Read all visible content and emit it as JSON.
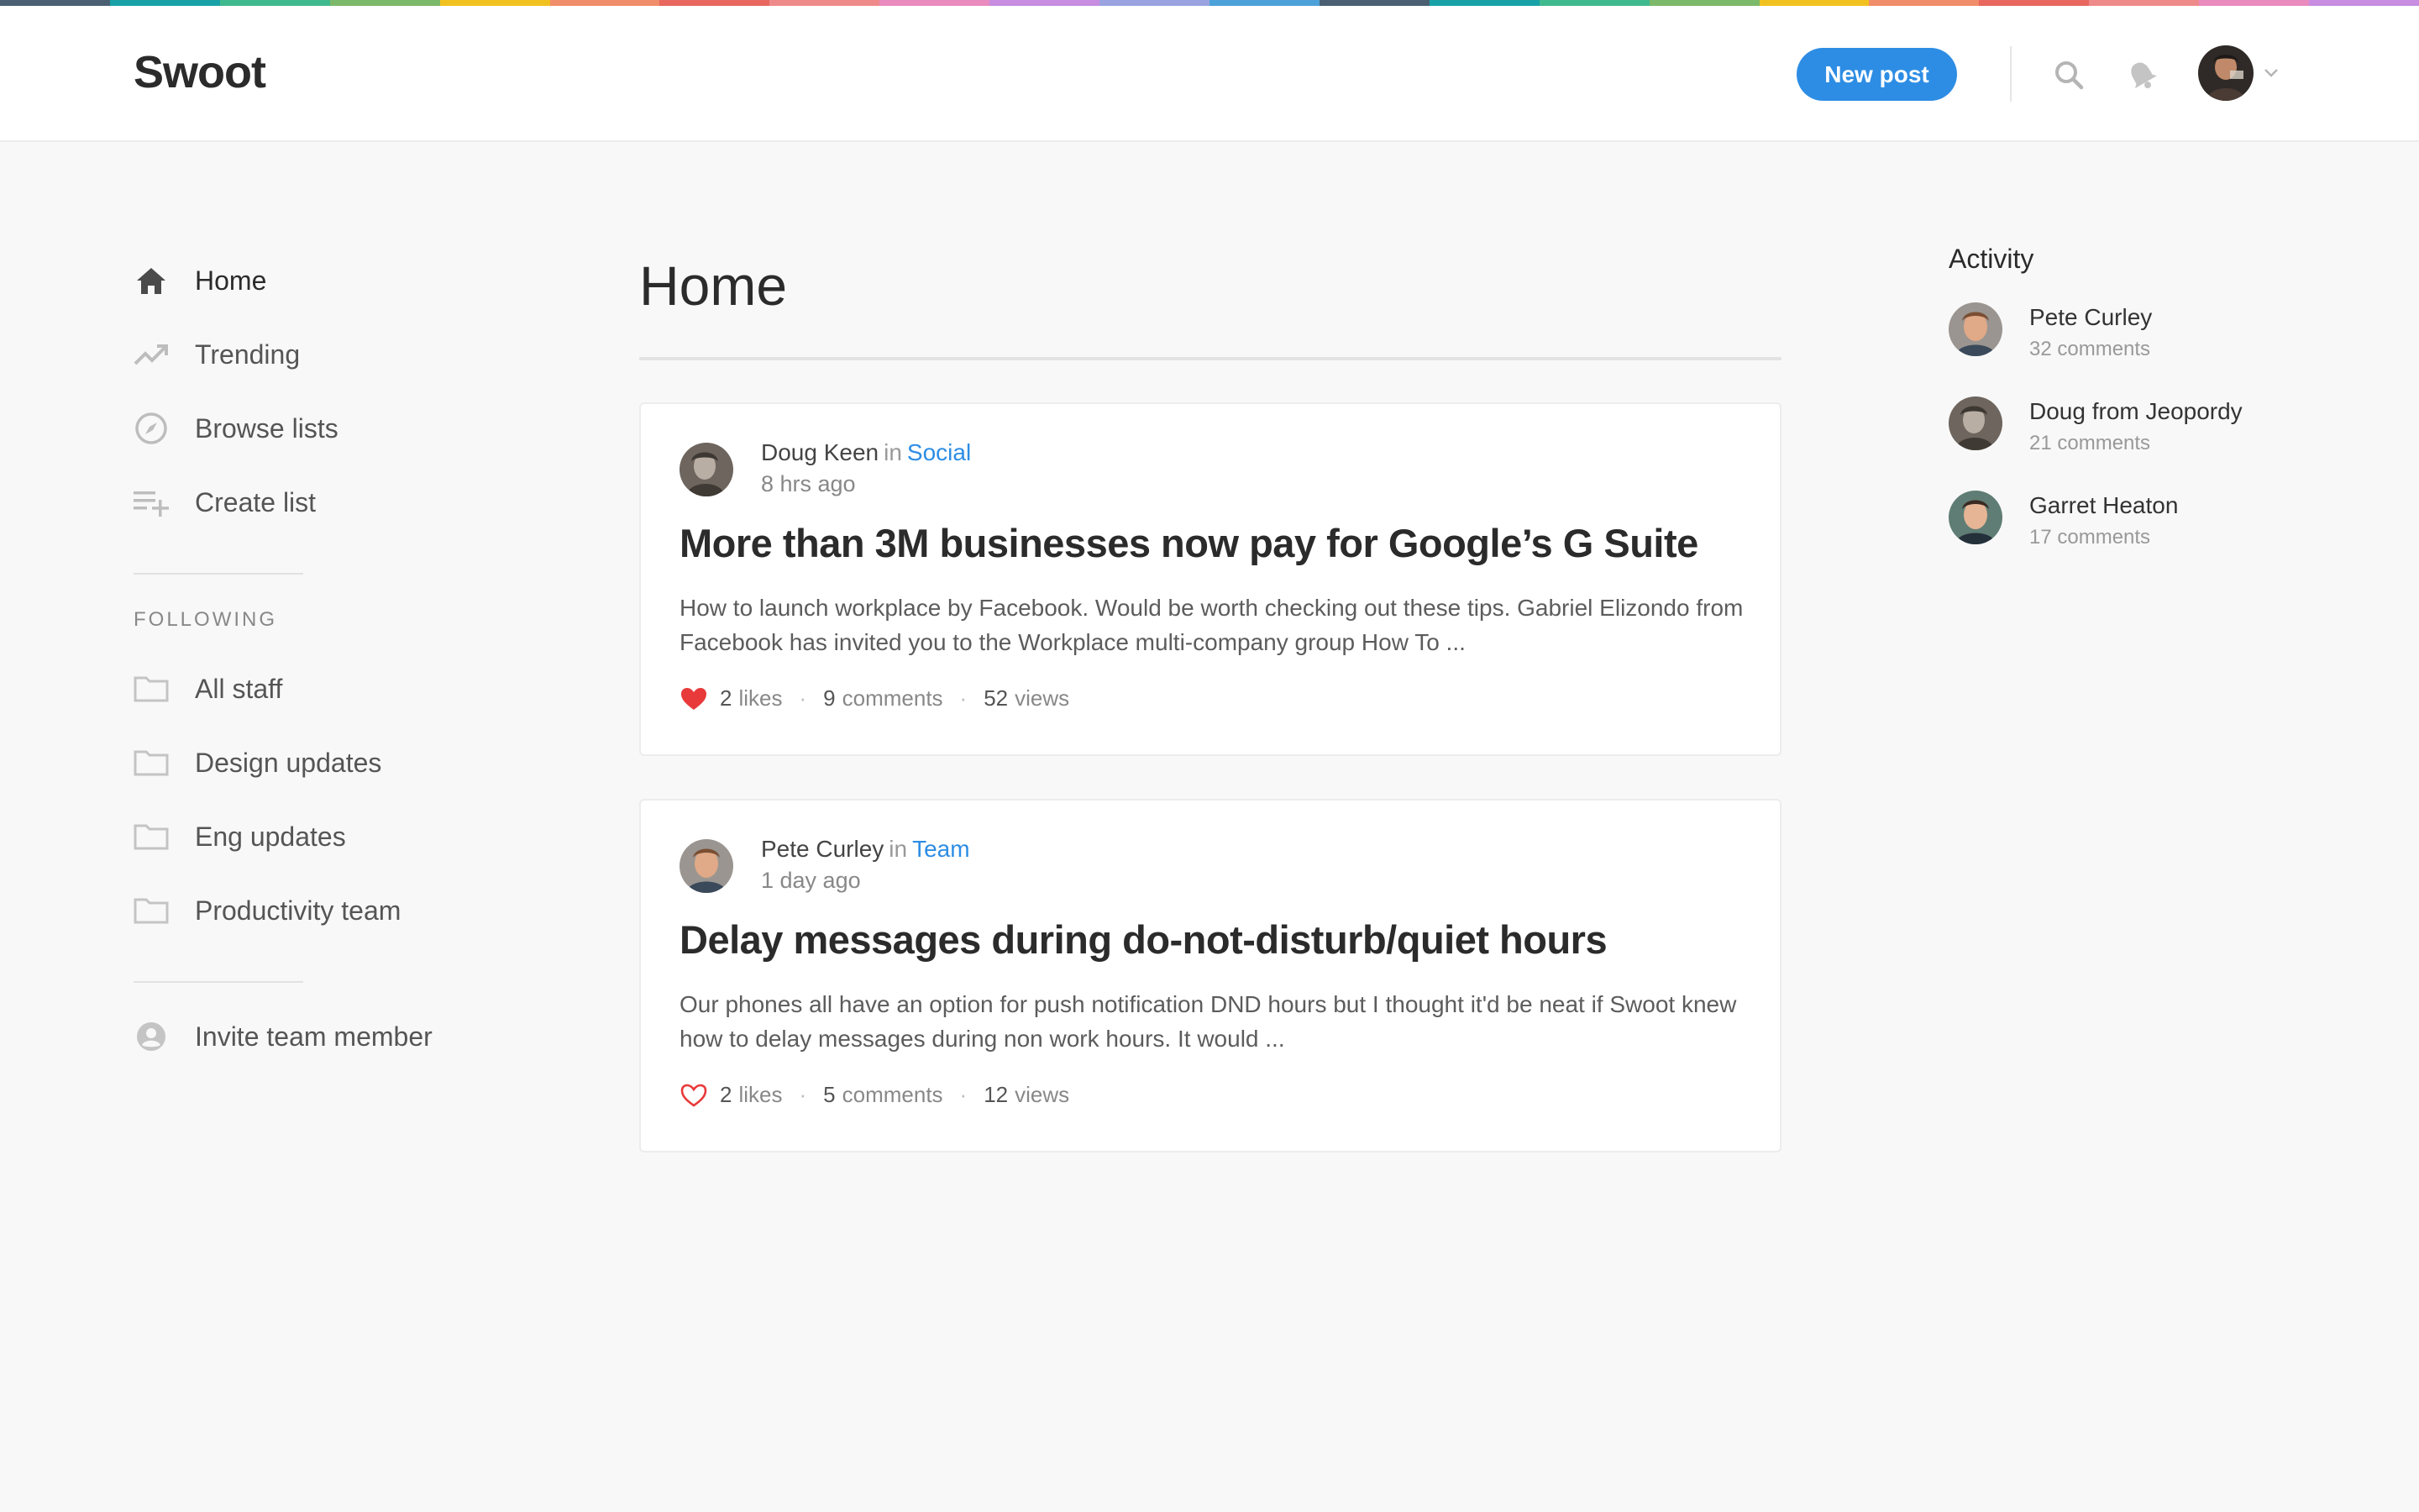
{
  "colors": {
    "accent": "#2d8de4",
    "heart_filled": "#e83a3a",
    "heart_outline": "#e83a3a",
    "stripe": [
      "#4a6072",
      "#18a2a8",
      "#3fb98e",
      "#7cb96a",
      "#f1c21f",
      "#f08d6b",
      "#e8675e",
      "#ef8a8a",
      "#e98bbf",
      "#c88ce0",
      "#9aa3e0",
      "#4da1d9",
      "#4a6072",
      "#18a2a8",
      "#3fb98e",
      "#7cb96a",
      "#f1c21f",
      "#f08d6b",
      "#e8675e",
      "#ef8a8a",
      "#e98bbf",
      "#c88ce0"
    ]
  },
  "header": {
    "logo": "Swoot",
    "new_post_label": "New post",
    "icons": [
      "search-icon",
      "bell-icon",
      "chevron-down-icon"
    ]
  },
  "sidebar": {
    "nav": [
      {
        "label": "Home",
        "icon": "home-icon"
      },
      {
        "label": "Trending",
        "icon": "trending-icon"
      },
      {
        "label": "Browse lists",
        "icon": "compass-icon"
      },
      {
        "label": "Create list",
        "icon": "playlist-add-icon"
      }
    ],
    "following_label": "FOLLOWING",
    "following": [
      {
        "label": "All staff",
        "icon": "folder-icon"
      },
      {
        "label": "Design updates",
        "icon": "folder-icon"
      },
      {
        "label": "Eng updates",
        "icon": "folder-icon"
      },
      {
        "label": "Productivity team",
        "icon": "folder-icon"
      }
    ],
    "invite_label": "Invite team member"
  },
  "main": {
    "title": "Home",
    "posts": [
      {
        "author": "Doug Keen",
        "in_word": "in",
        "channel": "Social",
        "time": "8 hrs ago",
        "title": "More than 3M businesses now pay for Google’s G Suite",
        "excerpt": "How to launch workplace by Facebook. Would be worth checking out these tips. Gabriel Elizondo from Facebook has invited you to the Workplace multi-company group How To ...",
        "likes_count": "2",
        "likes_label": "likes",
        "comments_count": "9",
        "comments_label": "comments",
        "views_count": "52",
        "views_label": "views",
        "liked": true
      },
      {
        "author": "Pete Curley",
        "in_word": "in",
        "channel": "Team",
        "time": "1 day ago",
        "title": "Delay messages during do-not-disturb/quiet hours",
        "excerpt": "Our phones all have an option for push notification DND hours but I thought it'd be neat if Swoot knew how to delay messages during non work hours. It would ...",
        "likes_count": "2",
        "likes_label": "likes",
        "comments_count": "5",
        "comments_label": "comments",
        "views_count": "12",
        "views_label": "views",
        "liked": false
      }
    ]
  },
  "activity": {
    "title": "Activity",
    "items": [
      {
        "name": "Pete Curley",
        "sub": "32 comments"
      },
      {
        "name": "Doug from Jeopordy",
        "sub": "21 comments"
      },
      {
        "name": "Garret Heaton",
        "sub": "17 comments"
      }
    ]
  }
}
